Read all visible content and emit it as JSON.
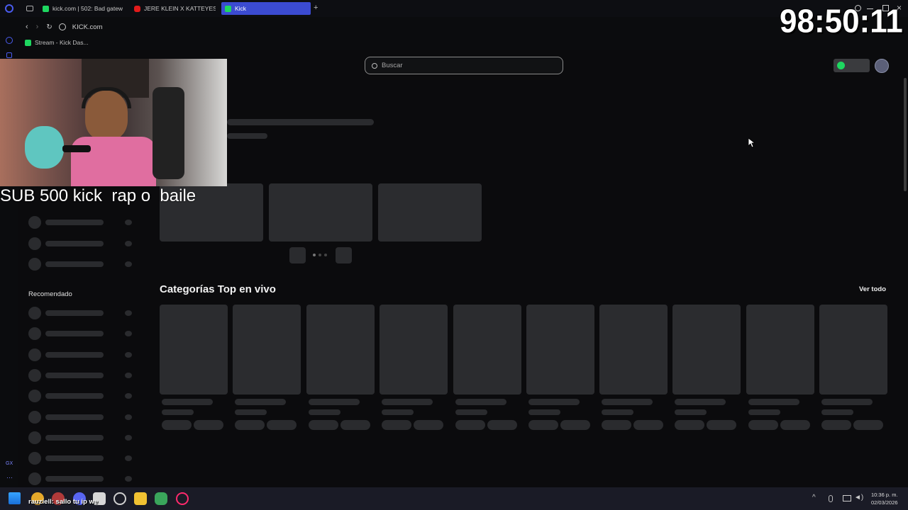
{
  "browser": {
    "tabs": [
      {
        "label": "kick.com | 502: Bad gatew",
        "favicon": "kick-icon"
      },
      {
        "label": "JERE KLEIN X KATTEYES",
        "favicon": "youtube-icon"
      },
      {
        "label": "Kick",
        "favicon": "kick-icon",
        "active": true
      }
    ],
    "new_tab_label": "+",
    "address": "KICK.com",
    "bookmark": "Stream - Kick Das..."
  },
  "page": {
    "search_placeholder": "Buscar",
    "section_recommended": "Recomendado",
    "section_categories": "Categorías Top en vivo",
    "view_all": "Ver todo"
  },
  "stream_overlay": {
    "caption": "SUB 500 kick  rap o  baile",
    "timer": "98:50:11"
  },
  "taskbar": {
    "chat_message": "rauziell: sallo tu ip we",
    "clock_time": "10:36 p. m.",
    "clock_date": "02/03/2026"
  },
  "colors": {
    "accent_tab": "#3b4bd1",
    "kick_green": "#1ed760",
    "skeleton": "#2b2c2f"
  }
}
